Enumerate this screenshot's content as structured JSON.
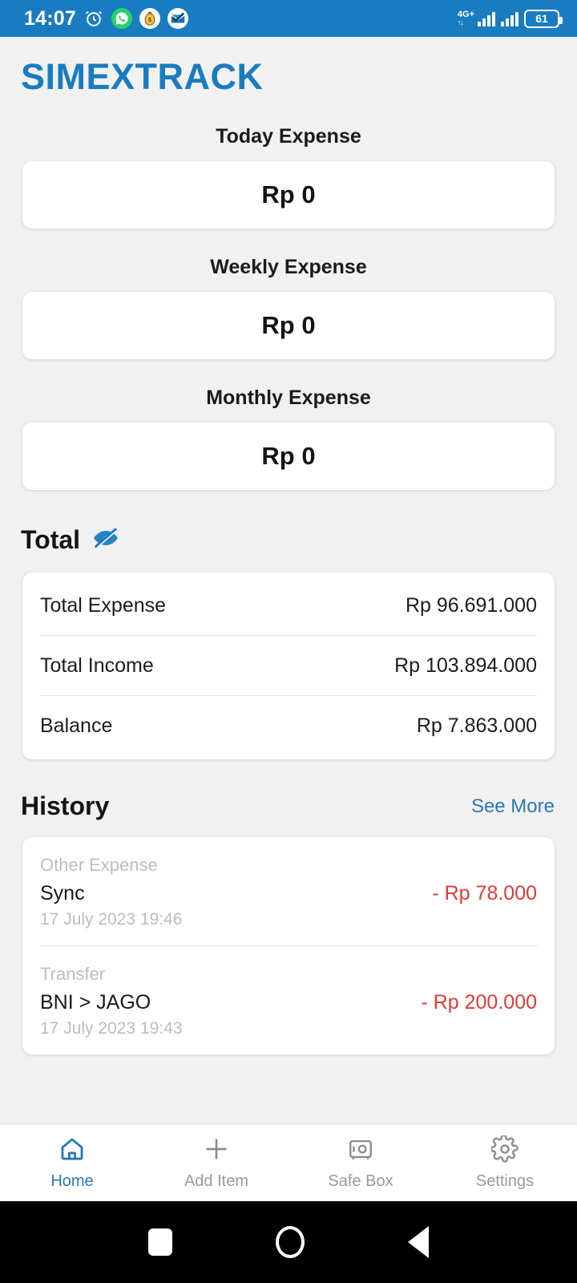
{
  "status_bar": {
    "time": "14:07",
    "icons": [
      "alarm-icon",
      "whatsapp-icon",
      "money-bag-app-icon",
      "mail-check-app-icon"
    ],
    "network_type": "4G+",
    "battery_percent": "61"
  },
  "header": {
    "brand": "SIMEXTRACK",
    "brand_color": "#1a7cc0"
  },
  "summary": [
    {
      "label": "Today Expense",
      "value": "Rp 0"
    },
    {
      "label": "Weekly Expense",
      "value": "Rp 0"
    },
    {
      "label": "Monthly Expense",
      "value": "Rp 0"
    }
  ],
  "total": {
    "heading": "Total",
    "visibility_icon": "eye-off-icon",
    "rows": [
      {
        "label": "Total Expense",
        "value": "Rp 96.691.000"
      },
      {
        "label": "Total Income",
        "value": "Rp 103.894.000"
      },
      {
        "label": "Balance",
        "value": "Rp 7.863.000"
      }
    ]
  },
  "history": {
    "heading": "History",
    "see_more": "See More",
    "items": [
      {
        "category": "Other Expense",
        "title": "Sync",
        "date": "17 July 2023 19:46",
        "amount": "- Rp 78.000"
      },
      {
        "category": "Transfer",
        "title": "BNI > JAGO",
        "date": "17 July 2023 19:43",
        "amount": "- Rp 200.000"
      }
    ],
    "amount_color": "#e53935"
  },
  "tabs": [
    {
      "label": "Home",
      "icon": "home-icon",
      "active": true
    },
    {
      "label": "Add Item",
      "icon": "plus-icon",
      "active": false
    },
    {
      "label": "Safe Box",
      "icon": "safe-box-icon",
      "active": false
    },
    {
      "label": "Settings",
      "icon": "gear-icon",
      "active": false
    }
  ],
  "android_nav": [
    "recents-square-icon",
    "home-circle-icon",
    "back-triangle-icon"
  ]
}
